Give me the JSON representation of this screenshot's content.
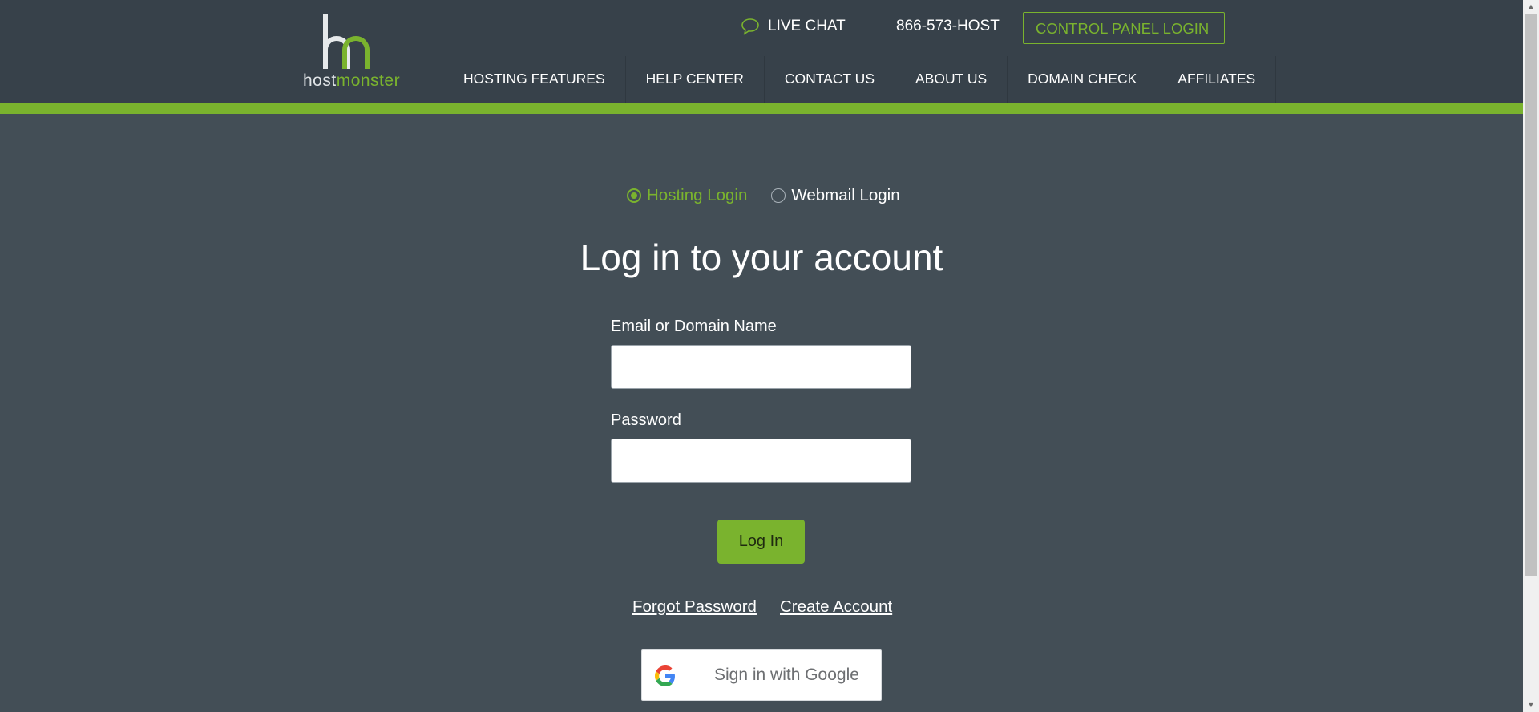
{
  "header": {
    "logo": {
      "host": "host",
      "monster": "monster"
    },
    "live_chat": "LIVE CHAT",
    "phone": "866-573-HOST",
    "control_panel_login": "CONTROL PANEL LOGIN",
    "nav": [
      {
        "label": "HOSTING FEATURES"
      },
      {
        "label": "HELP CENTER"
      },
      {
        "label": "CONTACT US"
      },
      {
        "label": "ABOUT US"
      },
      {
        "label": "DOMAIN CHECK"
      },
      {
        "label": "AFFILIATES"
      }
    ]
  },
  "login_type": {
    "options": [
      {
        "label": "Hosting Login",
        "selected": true
      },
      {
        "label": "Webmail Login",
        "selected": false
      }
    ]
  },
  "form": {
    "title": "Log in to your account",
    "email_label": "Email or Domain Name",
    "email_value": "",
    "password_label": "Password",
    "password_value": "",
    "submit_label": "Log In",
    "forgot_password": "Forgot Password",
    "create_account": "Create Account",
    "google_sign_in": "Sign in with Google"
  },
  "icons": {
    "chat": "chat-bubble-icon",
    "google": "google-g-icon",
    "logo": "hm-logo"
  },
  "colors": {
    "accent": "#7ab32e",
    "header_bg": "#37414a",
    "page_bg": "#434e56"
  }
}
